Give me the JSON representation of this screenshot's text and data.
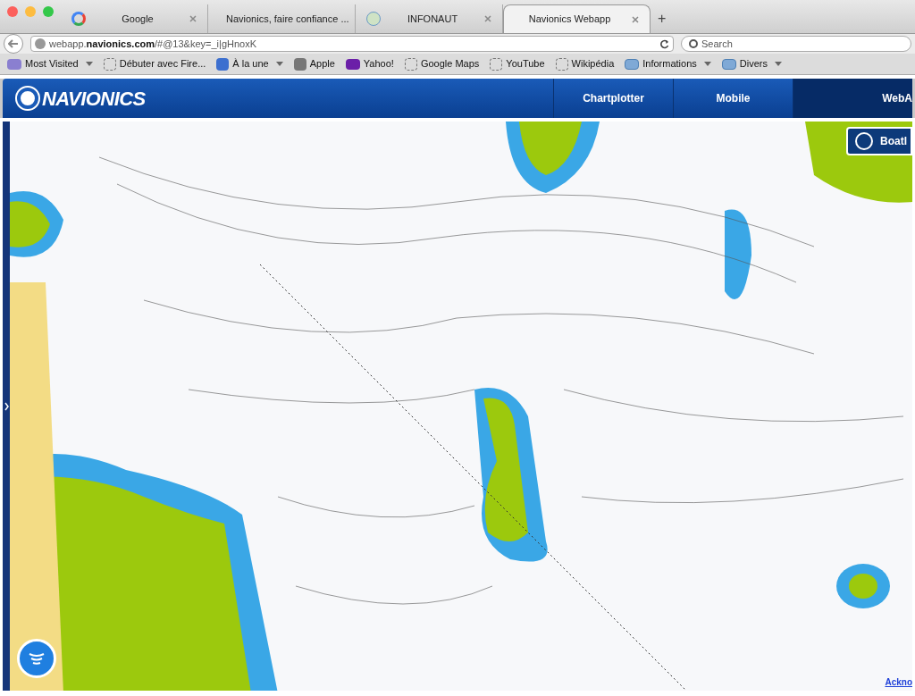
{
  "browser": {
    "tabs": [
      {
        "label": "Google",
        "kind": "google",
        "selected": false
      },
      {
        "label": "Navionics, faire confiance ...",
        "kind": "site",
        "selected": false
      },
      {
        "label": "INFONAUT",
        "kind": "globe",
        "selected": false
      },
      {
        "label": "Navionics Webapp",
        "kind": "plain",
        "selected": true
      }
    ],
    "new_tab": "+",
    "url": "webapp.**navionics.com**/#@13&key=_i|gHnoxK",
    "search": {
      "placeholder": "Search"
    },
    "bookmarks": [
      {
        "label": "Most Visited",
        "kind": "smart",
        "dropdown": true
      },
      {
        "label": "Débuter avec Fire...",
        "kind": "page",
        "dropdown": false
      },
      {
        "label": "À la une",
        "kind": "feed",
        "dropdown": true
      },
      {
        "label": "Apple",
        "kind": "apple",
        "dropdown": false
      },
      {
        "label": "Yahoo!",
        "kind": "yahoo",
        "dropdown": false
      },
      {
        "label": "Google Maps",
        "kind": "page",
        "dropdown": false
      },
      {
        "label": "YouTube",
        "kind": "page",
        "dropdown": false
      },
      {
        "label": "Wikipédia",
        "kind": "page",
        "dropdown": false
      },
      {
        "label": "Informations",
        "kind": "folder",
        "dropdown": true
      },
      {
        "label": "Divers",
        "kind": "folder",
        "dropdown": true
      }
    ]
  },
  "header": {
    "logo": "NAVIONICS",
    "nav": [
      {
        "label": "Chartplotter",
        "selected": false
      },
      {
        "label": "Mobile",
        "selected": false
      },
      {
        "label": "WebA",
        "selected": true
      }
    ]
  },
  "map": {
    "boating_button": "Boatl",
    "link": "Ackno"
  }
}
